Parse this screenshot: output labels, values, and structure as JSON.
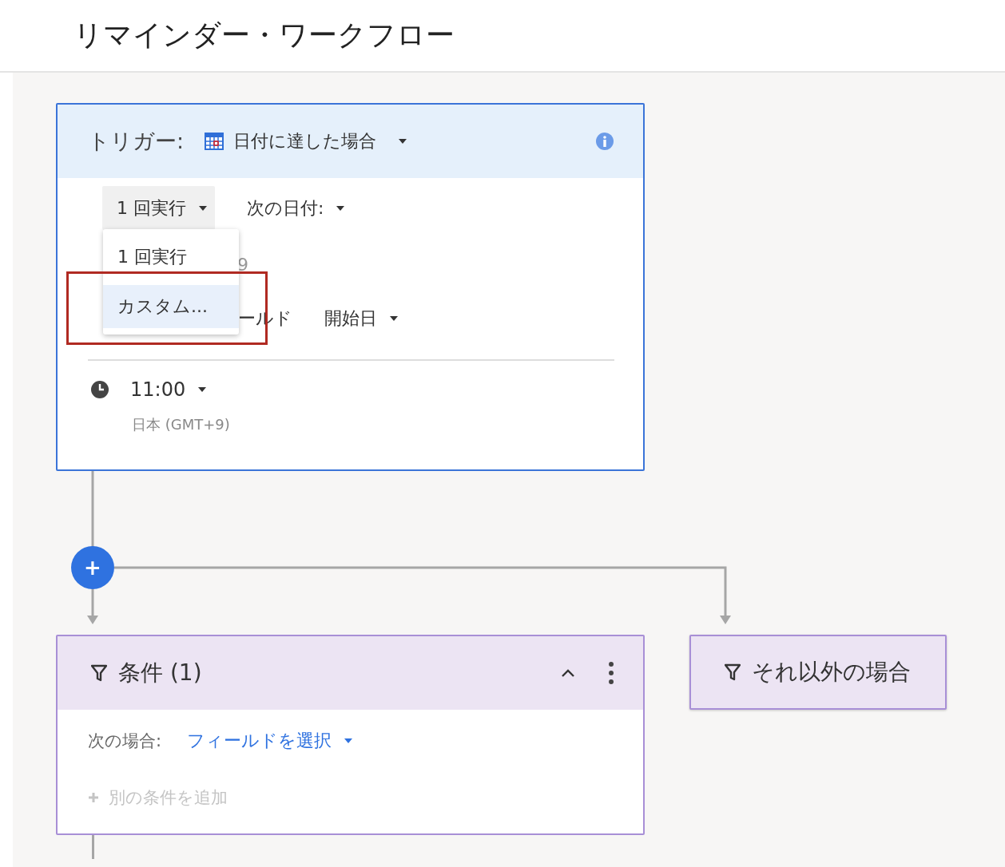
{
  "page": {
    "title": "リマインダー・ワークフロー"
  },
  "trigger": {
    "label": "トリガー:",
    "type": "日付に達した場合",
    "repeat": {
      "value": "1 回実行"
    },
    "next_date": {
      "label": "次の日付:"
    },
    "covered_row_text": "9",
    "field_row": {
      "covered_label": "ールド",
      "value": "開始日"
    },
    "time": {
      "value": "11:00",
      "timezone": "日本 (GMT+9)"
    },
    "menu": {
      "items": [
        {
          "label": "1 回実行",
          "selected": false
        },
        {
          "label": "カスタム...",
          "selected": true
        }
      ],
      "highlighted": true
    }
  },
  "add_step": {
    "symbol": "+"
  },
  "condition": {
    "title": "条件 (1)",
    "expanded": true,
    "when_label": "次の場合:",
    "field_select": "フィールドを選択",
    "add_condition": "別の条件を追加"
  },
  "otherwise": {
    "title": "それ以外の場合"
  }
}
